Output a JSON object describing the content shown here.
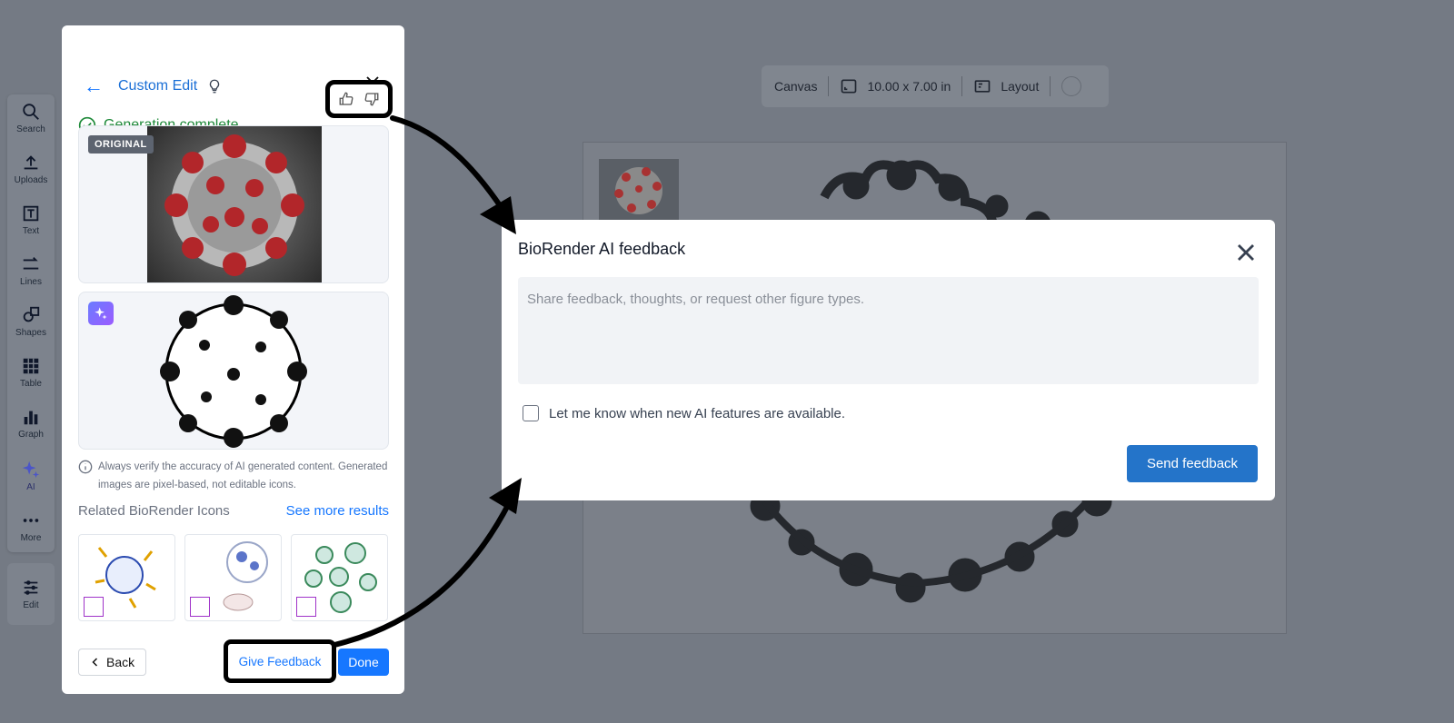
{
  "toolbar": {
    "tools": [
      {
        "label": "Search",
        "icon": "search-icon"
      },
      {
        "label": "Uploads",
        "icon": "upload-icon"
      },
      {
        "label": "Text",
        "icon": "text-icon"
      },
      {
        "label": "Lines",
        "icon": "lines-icon"
      },
      {
        "label": "Shapes",
        "icon": "shapes-icon"
      },
      {
        "label": "Table",
        "icon": "table-icon"
      },
      {
        "label": "Graph",
        "icon": "graph-icon"
      },
      {
        "label": "AI",
        "icon": "sparkle-icon"
      },
      {
        "label": "More",
        "icon": "more-icon"
      }
    ],
    "edit_label": "Edit"
  },
  "canvas_toolbar": {
    "canvas_label": "Canvas",
    "size_label": "10.00 x 7.00 in",
    "layout_label": "Layout"
  },
  "panel": {
    "title": "Custom Edit",
    "status": "Generation complete",
    "original_badge": "ORIGINAL",
    "disclaimer": "Always verify the accuracy of AI generated content. Generated images are pixel-based, not editable icons.",
    "related_label": "Related BioRender Icons",
    "see_more": "See more results",
    "back_label": "Back",
    "feedback_label": "Give Feedback",
    "done_label": "Done"
  },
  "modal": {
    "title": "BioRender AI feedback",
    "placeholder": "Share feedback, thoughts, or request other figure types.",
    "checkbox_label": "Let me know when new AI features are available.",
    "send_label": "Send feedback"
  },
  "colors": {
    "accent": "#1677ff",
    "send_button": "#2474c9",
    "success": "#1f8a3a",
    "backdrop": "#747a84"
  }
}
